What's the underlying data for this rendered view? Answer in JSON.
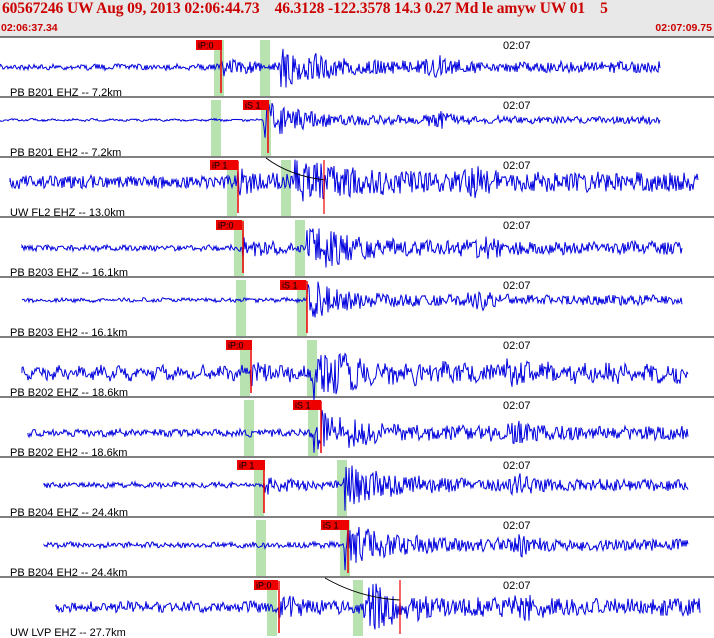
{
  "header": {
    "title": "60567246 UW Aug 09, 2013 02:06:44.73    46.3128 -122.3578 14.3 0.27 Md le amyw UW 01    5",
    "start_time": "02:06:37.34",
    "end_time": "02:07:09.75"
  },
  "time_mark_label": "02:07",
  "colors": {
    "trace": "#0000dd",
    "pick": "#ee0000",
    "window": "#b8e2b0",
    "header_bg": "#e8e8e8",
    "header_text": "#cc0000"
  },
  "traces": [
    {
      "label": "PB B201 EHZ -- 7.2km",
      "pick": "iP:0"
    },
    {
      "label": "PB B201 EH2 -- 7.2km",
      "pick": "iS 1"
    },
    {
      "label": "UW FL2 EHZ -- 13.0km",
      "pick": "iP 1"
    },
    {
      "label": "PB B203 EHZ -- 16.1km",
      "pick": "iP:0"
    },
    {
      "label": "PB B203 EH2 -- 16.1km",
      "pick": "iS 1"
    },
    {
      "label": "PB B202 EHZ -- 18.6km",
      "pick": "iP:0"
    },
    {
      "label": "PB B202 EH2 -- 18.6km",
      "pick": "iS 1"
    },
    {
      "label": "PB B204 EHZ -- 24.4km",
      "pick": "iP 1"
    },
    {
      "label": "PB B204 EH2 -- 24.4km",
      "pick": "iS 1"
    },
    {
      "label": "UW LVP EHZ -- 27.7km",
      "pick": "iP:0"
    }
  ]
}
